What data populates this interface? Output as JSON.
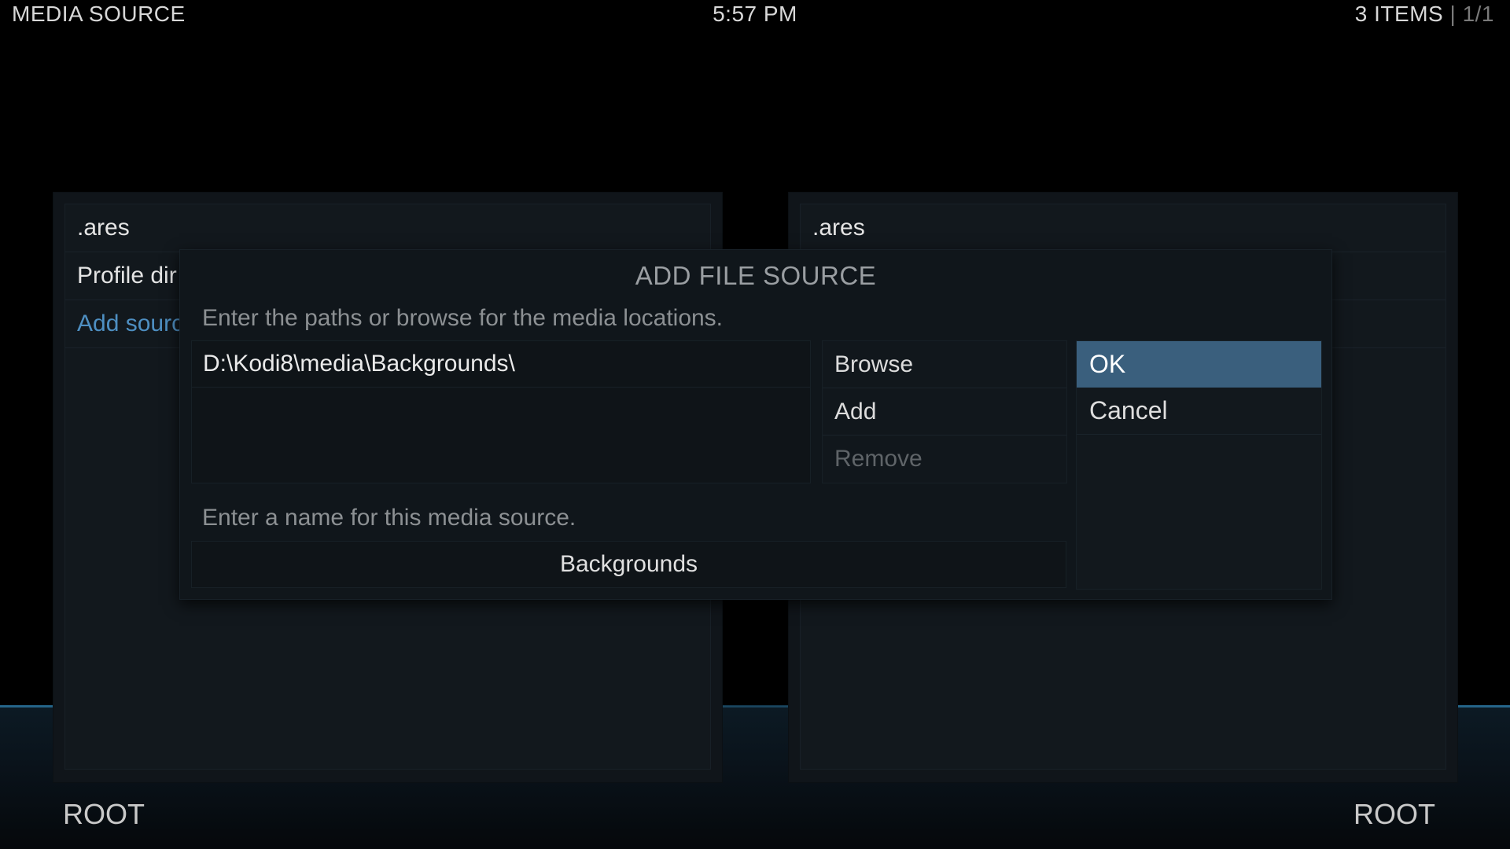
{
  "topbar": {
    "left_title": "MEDIA SOURCE",
    "clock": "5:57 PM",
    "items_count": "3 ITEMS",
    "separator": "|",
    "page": "1/1"
  },
  "left_panel": {
    "items": [
      ".ares",
      "Profile dir",
      "Add sourc"
    ],
    "footer": "ROOT"
  },
  "right_panel": {
    "items": [
      ".ares"
    ],
    "footer": "ROOT"
  },
  "dialog": {
    "title": "ADD FILE SOURCE",
    "paths_hint": "Enter the paths or browse for the media locations.",
    "paths": [
      "D:\\Kodi8\\media\\Backgrounds\\"
    ],
    "browse_label": "Browse",
    "add_label": "Add",
    "remove_label": "Remove",
    "ok_label": "OK",
    "cancel_label": "Cancel",
    "name_hint": "Enter a name for this media source.",
    "name_value": "Backgrounds"
  },
  "colors": {
    "accent_blue": "#4e8fc2",
    "focus_highlight": "#3a5f7d",
    "background": "#000000"
  }
}
